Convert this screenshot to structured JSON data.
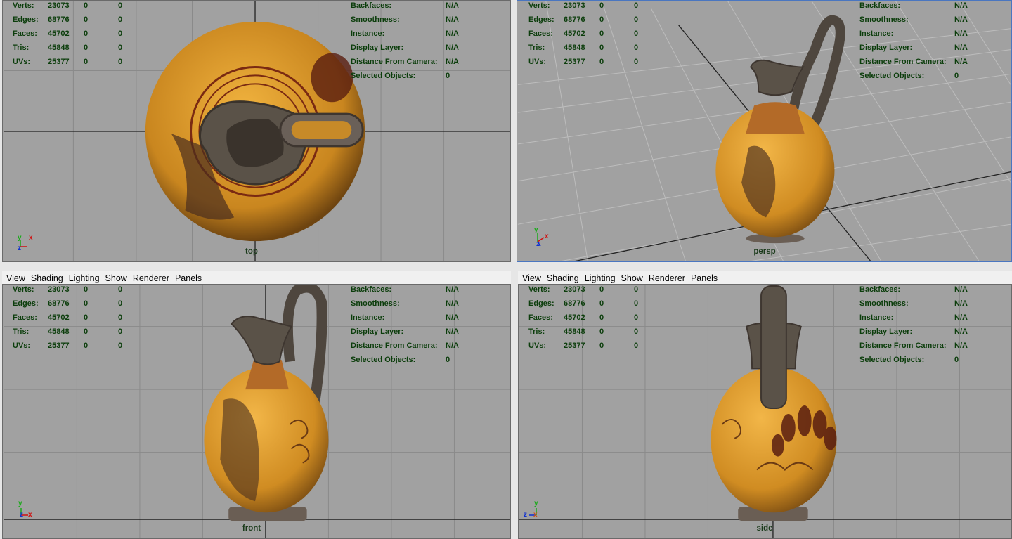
{
  "menu": [
    "View",
    "Shading",
    "Lighting",
    "Show",
    "Renderer",
    "Panels"
  ],
  "hud_left": {
    "rows": [
      {
        "label": "Verts:",
        "values": [
          "23073",
          "0",
          "0"
        ]
      },
      {
        "label": "Edges:",
        "values": [
          "68776",
          "0",
          "0"
        ]
      },
      {
        "label": "Faces:",
        "values": [
          "45702",
          "0",
          "0"
        ]
      },
      {
        "label": "Tris:",
        "values": [
          "45848",
          "0",
          "0"
        ]
      },
      {
        "label": "UVs:",
        "values": [
          "25377",
          "0",
          "0"
        ]
      }
    ]
  },
  "hud_right": {
    "rows": [
      {
        "label": "Backfaces:",
        "value": "N/A"
      },
      {
        "label": "Smoothness:",
        "value": "N/A"
      },
      {
        "label": "Instance:",
        "value": "N/A"
      },
      {
        "label": "Display Layer:",
        "value": "N/A"
      },
      {
        "label": "Distance From Camera:",
        "value": "N/A"
      },
      {
        "label": "Selected Objects:",
        "value": "0"
      }
    ]
  },
  "viewports": {
    "top": "top",
    "persp": "persp",
    "front": "front",
    "side": "side"
  },
  "axes": {
    "x": "x",
    "y": "y",
    "z": "z"
  },
  "colors": {
    "viewport_bg": "#a1a1a1",
    "hud_text": "#0b3d0b",
    "vase_body": "#d8942a",
    "vase_dark": "#5a4e42",
    "menubar_bg": "#f0f0f0"
  }
}
